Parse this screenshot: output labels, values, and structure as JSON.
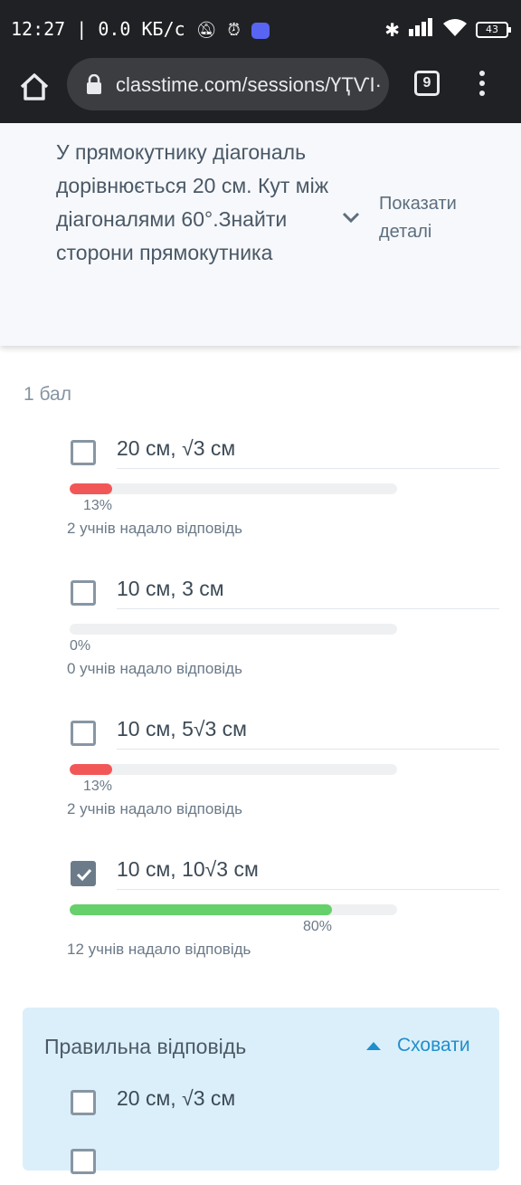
{
  "status_bar": {
    "time_speed": "12:27 | 0.0 КБ/с",
    "battery": "43"
  },
  "browser": {
    "url": "classtime.com/sessions/ҮҬѴІ·",
    "tab_count": "9"
  },
  "question": {
    "text": "У прямокутнику діагональ дорівнюється 20 см. Кут між діагоналями 60°.Знайти сторони прямокутника",
    "details_label": "Показати деталі"
  },
  "points_label": "1 бал",
  "options": [
    {
      "label": "20 см, √3 см",
      "checked": false,
      "percent": 13,
      "percent_label": "13%",
      "count_label": "2 учнів надало відповідь",
      "bar_color": "#f25757"
    },
    {
      "label": "10 см, 3 см",
      "checked": false,
      "percent": 0,
      "percent_label": "0%",
      "count_label": "0 учнів надало відповідь",
      "bar_color": "#f25757"
    },
    {
      "label": "10 см, 5√3 см",
      "checked": false,
      "percent": 13,
      "percent_label": "13%",
      "count_label": "2 учнів надало відповідь",
      "bar_color": "#f25757"
    },
    {
      "label": "10 см, 10√3 см",
      "checked": true,
      "percent": 80,
      "percent_label": "80%",
      "count_label": "12 учнів надало відповідь",
      "bar_color": "#66d06a"
    }
  ],
  "correct_answer": {
    "title": "Правильна відповідь",
    "hide_label": "Сховати",
    "options": [
      {
        "label": "20 см, √3 см",
        "checked": false
      }
    ]
  }
}
